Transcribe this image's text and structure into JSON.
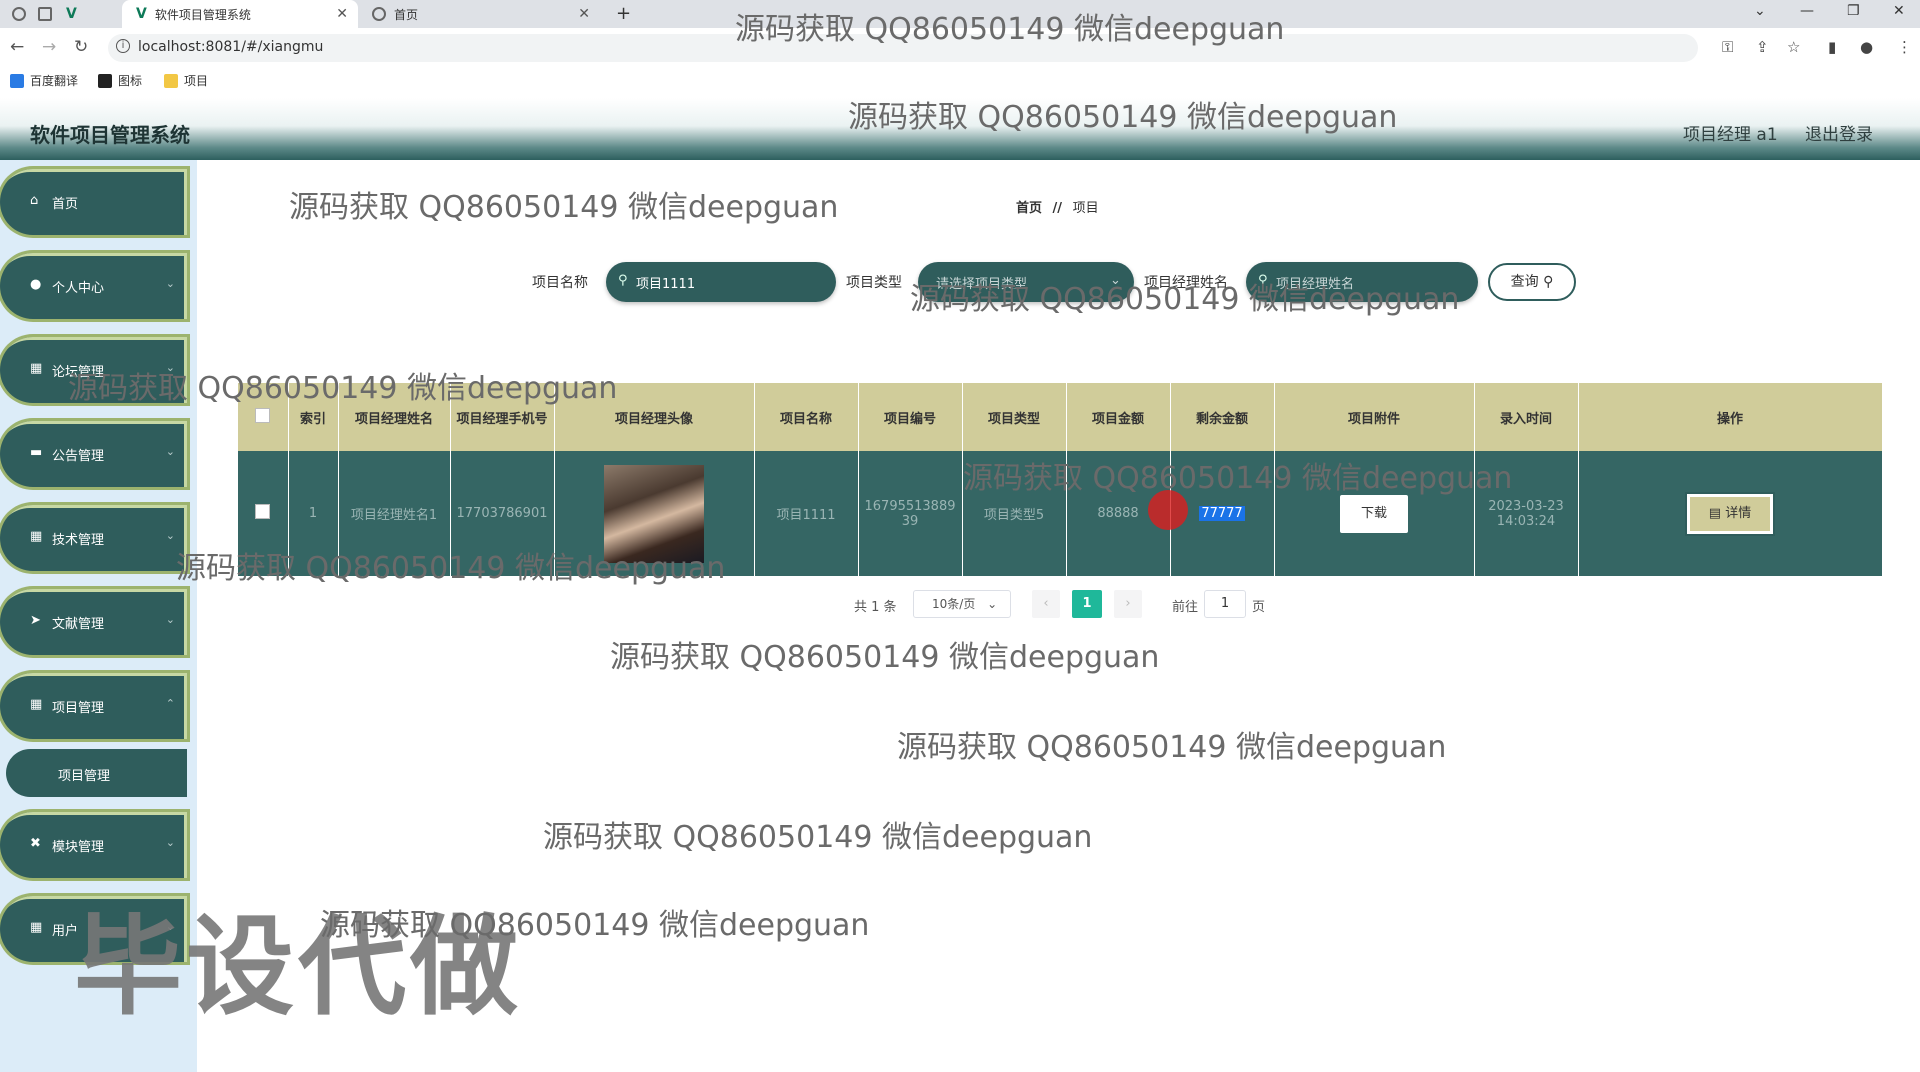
{
  "browser": {
    "tabs": [
      {
        "title": "软件项目管理系统",
        "close": "✕"
      },
      {
        "title": "首页",
        "close": "✕"
      }
    ],
    "new_tab": "+",
    "url": "localhost:8081/#/xiangmu",
    "bookmarks": [
      "百度翻译",
      "图标",
      "项目"
    ],
    "window_controls": [
      "⌄",
      "—",
      "❐",
      "✕"
    ]
  },
  "header": {
    "app_title": "软件项目管理系统",
    "user": "项目经理 a1",
    "logout": "退出登录"
  },
  "sidebar": {
    "items": [
      {
        "label": "首页",
        "icon": "home-icon",
        "glyph": "⌂",
        "has_chevron": false
      },
      {
        "label": "个人中心",
        "icon": "user-icon",
        "glyph": "👤",
        "has_chevron": true
      },
      {
        "label": "论坛管理",
        "icon": "grid-icon",
        "glyph": "▦",
        "has_chevron": true
      },
      {
        "label": "公告管理",
        "icon": "monitor-icon",
        "glyph": "▬",
        "has_chevron": true
      },
      {
        "label": "技术管理",
        "icon": "grid-icon",
        "glyph": "▦",
        "has_chevron": true
      },
      {
        "label": "文献管理",
        "icon": "send-icon",
        "glyph": "➤",
        "has_chevron": true
      },
      {
        "label": "项目管理",
        "icon": "grid-icon",
        "glyph": "▦",
        "has_chevron": true
      },
      {
        "label": "模块管理",
        "icon": "ticket-icon",
        "glyph": "✖",
        "has_chevron": true
      },
      {
        "label": "用户",
        "icon": "grid-icon",
        "glyph": "▦",
        "has_chevron": true
      }
    ],
    "sub_item": "项目管理",
    "chevron": "⌄"
  },
  "breadcrumb": {
    "home": "首页",
    "sep": "//",
    "current": "项目"
  },
  "search": {
    "name_label": "项目名称",
    "name_value": "项目1111",
    "type_label": "项目类型",
    "type_placeholder": "请选择项目类型",
    "manager_label": "项目经理姓名",
    "manager_placeholder": "项目经理姓名",
    "query_button": "查询"
  },
  "table": {
    "columns": [
      "索引",
      "项目经理姓名",
      "项目经理手机号",
      "项目经理头像",
      "项目名称",
      "项目编号",
      "项目类型",
      "项目金额",
      "剩余金额",
      "项目附件",
      "录入时间",
      "操作"
    ],
    "rows": [
      {
        "index": "1",
        "manager_name": "项目经理姓名1",
        "phone": "17703786901",
        "project_name": "项目1111",
        "project_no": "1679551388939",
        "project_type": "项目类型5",
        "amount": "88888",
        "remaining": "77777",
        "attachment_button": "下载",
        "created": "2023-03-23 14:03:24",
        "detail_button": "详情"
      }
    ]
  },
  "pagination": {
    "total": "共 1 条",
    "page_size": "10条/页",
    "current_page": "1",
    "goto_label": "前往",
    "goto_value": "1",
    "page_unit": "页"
  },
  "watermarks": {
    "text": "源码获取 QQ86050149 微信deepguan",
    "big": "毕设代做"
  }
}
